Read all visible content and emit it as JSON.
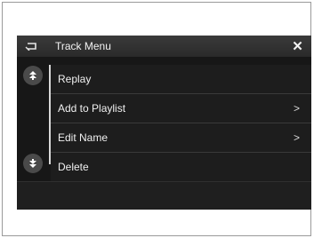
{
  "header": {
    "title": "Track Menu",
    "back_icon": "back-arrow-icon",
    "close_label": "✕"
  },
  "scroll": {
    "up_icon": "scroll-up-icon",
    "down_icon": "scroll-down-icon"
  },
  "menu": {
    "items": [
      {
        "label": "Replay",
        "chevron": ""
      },
      {
        "label": "Add to Playlist",
        "chevron": ">"
      },
      {
        "label": "Edit Name",
        "chevron": ">"
      },
      {
        "label": "Delete",
        "chevron": ""
      }
    ]
  },
  "colors": {
    "screen_bg": "#171717",
    "header_bg": "#333333",
    "text": "#f0f0f0"
  }
}
